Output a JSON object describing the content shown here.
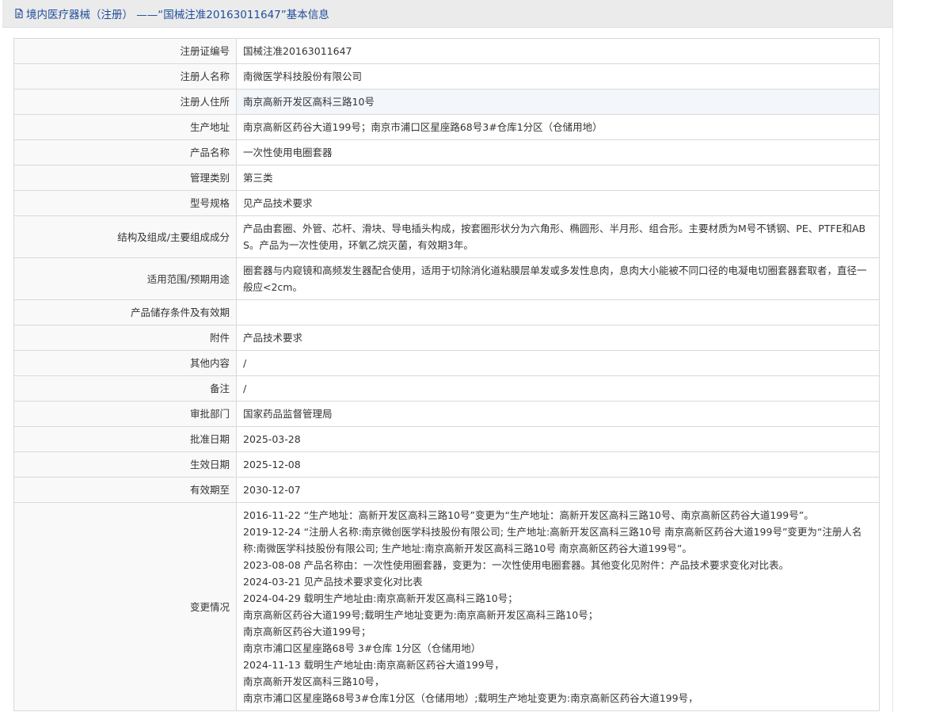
{
  "header": {
    "title": "境内医疗器械（注册） ——“国械注准20163011647”基本信息"
  },
  "fields": [
    {
      "label": "注册证编号",
      "value": "国械注准20163011647"
    },
    {
      "label": "注册人名称",
      "value": "南微医学科技股份有限公司"
    },
    {
      "label": "注册人住所",
      "value": "南京高新开发区高科三路10号"
    },
    {
      "label": "生产地址",
      "value": "南京高新区药谷大道199号；南京市浦口区星座路68号3#仓库1分区（仓储用地）"
    },
    {
      "label": "产品名称",
      "value": "一次性使用电圈套器"
    },
    {
      "label": "管理类别",
      "value": "第三类"
    },
    {
      "label": "型号规格",
      "value": "见产品技术要求"
    },
    {
      "label": "结构及组成/主要组成成分",
      "value": "产品由套圈、外管、芯杆、滑块、导电插头构成，按套圈形状分为六角形、椭圆形、半月形、组合形。主要材质为M号不锈钢、PE、PTFE和ABS。产品为一次性使用，环氧乙烷灭菌，有效期3年。"
    },
    {
      "label": "适用范围/预期用途",
      "value": "圈套器与内窥镜和高频发生器配合使用，适用于切除消化道粘膜层单发或多发性息肉，息肉大小能被不同口径的电凝电切圈套器套取者，直径一般应<2cm。"
    },
    {
      "label": "产品储存条件及有效期",
      "value": ""
    },
    {
      "label": "附件",
      "value": "产品技术要求"
    },
    {
      "label": "其他内容",
      "value": "/"
    },
    {
      "label": "备注",
      "value": "/"
    },
    {
      "label": "审批部门",
      "value": "国家药品监督管理局"
    },
    {
      "label": "批准日期",
      "value": "2025-03-28"
    },
    {
      "label": "生效日期",
      "value": "2025-12-08"
    },
    {
      "label": "有效期至",
      "value": "2030-12-07"
    }
  ],
  "changes": {
    "label": "变更情况",
    "lines": [
      "2016-11-22 “生产地址：高新开发区高科三路10号”变更为“生产地址：高新开发区高科三路10号、南京高新区药谷大道199号”。",
      "2019-12-24 “注册人名称:南京微创医学科技股份有限公司; 生产地址:高新开发区高科三路10号 南京高新区药谷大道199号”变更为“注册人名称:南微医学科技股份有限公司; 生产地址:南京高新开发区高科三路10号 南京高新区药谷大道199号”。",
      "2023-08-08 产品名称由：一次性使用圈套器，变更为：一次性使用电圈套器。其他变化见附件：产品技术要求变化对比表。",
      "2024-03-21 见产品技术要求变化对比表",
      "2024-04-29 载明生产地址由:南京高新开发区高科三路10号；",
      "南京高新区药谷大道199号;载明生产地址变更为:南京高新开发区高科三路10号；",
      "南京高新区药谷大道199号；",
      "南京市浦口区星座路68号 3#仓库 1分区（仓储用地）",
      "2024-11-13 载明生产地址由:南京高新区药谷大道199号，",
      "南京高新开发区高科三路10号，",
      "南京市浦口区星座路68号3#仓库1分区（仓储用地）;载明生产地址变更为:南京高新区药谷大道199号，"
    ]
  },
  "colors": {
    "title": "#1f4e9b",
    "header_bg": "#ebebeb",
    "label_bg": "#f9f9f9",
    "border": "#d9d9d9"
  }
}
